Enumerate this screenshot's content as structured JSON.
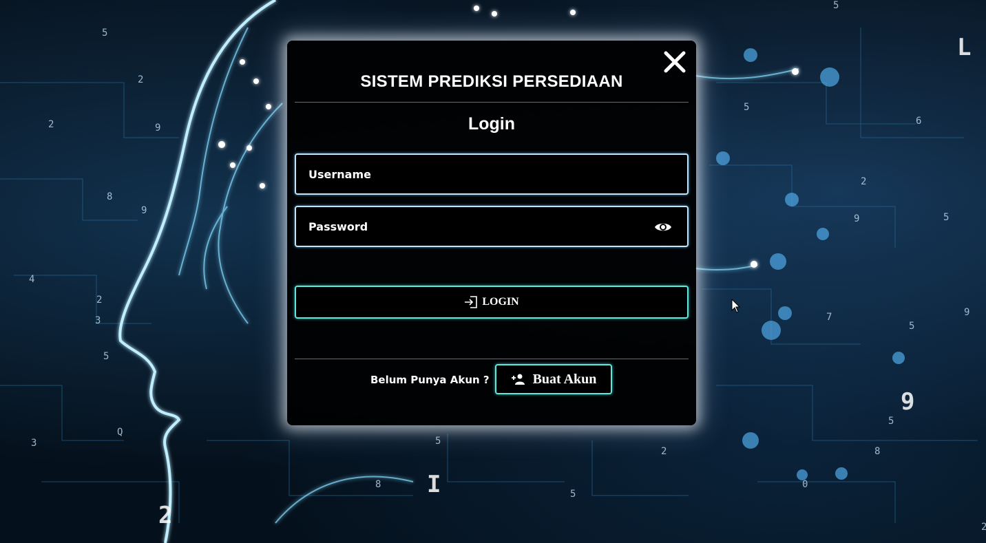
{
  "modal": {
    "title": "SISTEM PREDIKSI PERSEDIAAN",
    "subtitle": "Login",
    "username_placeholder": "Username",
    "password_placeholder": "Password",
    "login_label": "LOGIN",
    "no_account_text": "Belum Punya Akun ?",
    "create_account_label": "Buat Akun"
  },
  "icons": {
    "close": "close-icon",
    "show_password": "eye-icon",
    "login": "login-icon",
    "add_user": "add-user-icon"
  },
  "colors": {
    "button_border": "#5ee8e0",
    "field_border": "#bfe6ff",
    "modal_background": "#000000"
  }
}
